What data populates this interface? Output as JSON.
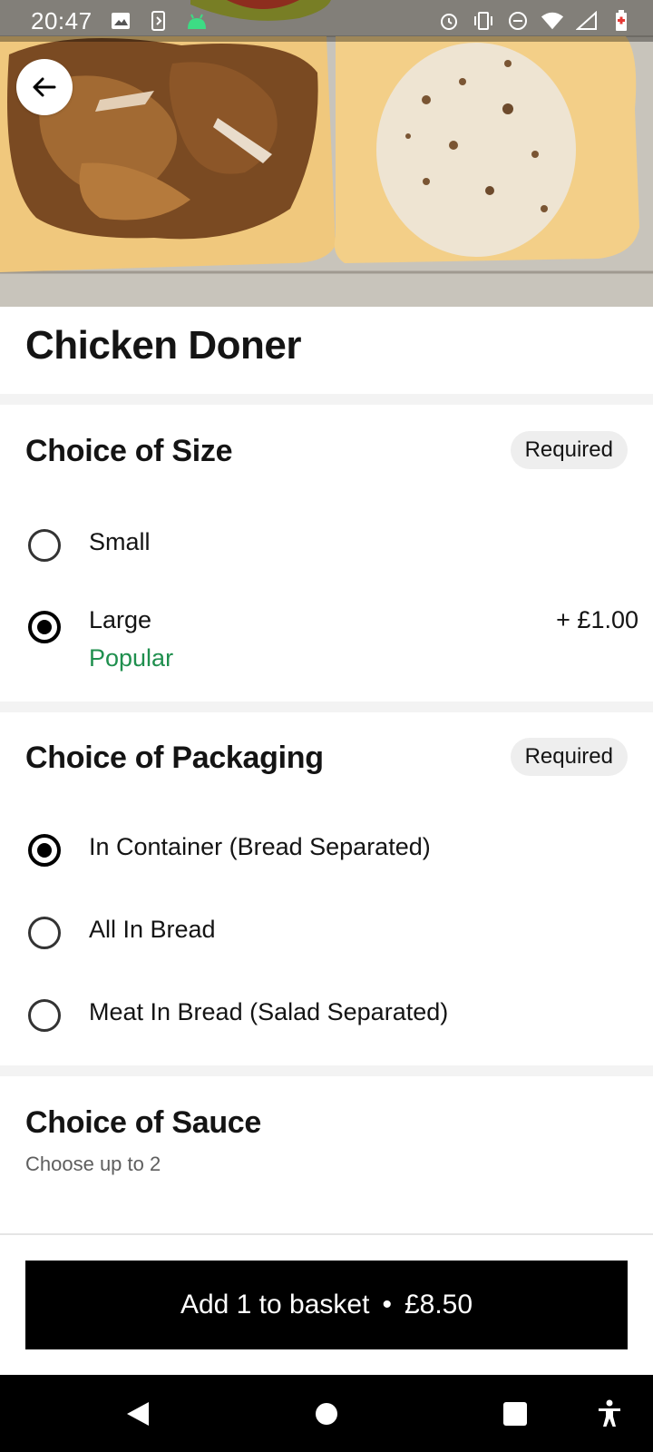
{
  "status_bar": {
    "time": "20:47",
    "left_icons": [
      "image-icon",
      "screen-rotation-icon",
      "android-icon"
    ],
    "right_icons": [
      "alarm-icon",
      "vibrate-icon",
      "do-not-disturb-icon",
      "wifi-icon",
      "signal-icon",
      "battery-low-icon"
    ]
  },
  "header": {
    "back_icon": "arrow-left-icon"
  },
  "item": {
    "title": "Chicken Doner"
  },
  "size_section": {
    "title": "Choice of Size",
    "badge": "Required",
    "options": [
      {
        "label": "Small",
        "price": "",
        "tag": "",
        "selected": false
      },
      {
        "label": "Large",
        "price": "+ £1.00",
        "tag": "Popular",
        "selected": true
      }
    ]
  },
  "packaging_section": {
    "title": "Choice of Packaging",
    "badge": "Required",
    "options": [
      {
        "label": "In Container (Bread Separated)",
        "selected": true
      },
      {
        "label": "All In Bread",
        "selected": false
      },
      {
        "label": "Meat In Bread (Salad Separated)",
        "selected": false
      }
    ]
  },
  "sauce_section": {
    "title": "Choice of Sauce",
    "subtitle": "Choose up to 2"
  },
  "footer": {
    "add_label": "Add 1 to basket",
    "separator": "•",
    "price": "£8.50"
  },
  "nav_bar": {
    "icons": [
      "back-triangle-icon",
      "home-circle-icon",
      "recents-square-icon",
      "accessibility-icon"
    ]
  },
  "colors": {
    "popular": "#1f8f4e",
    "button_bg": "#000000",
    "badge_bg": "#eeeeee"
  }
}
